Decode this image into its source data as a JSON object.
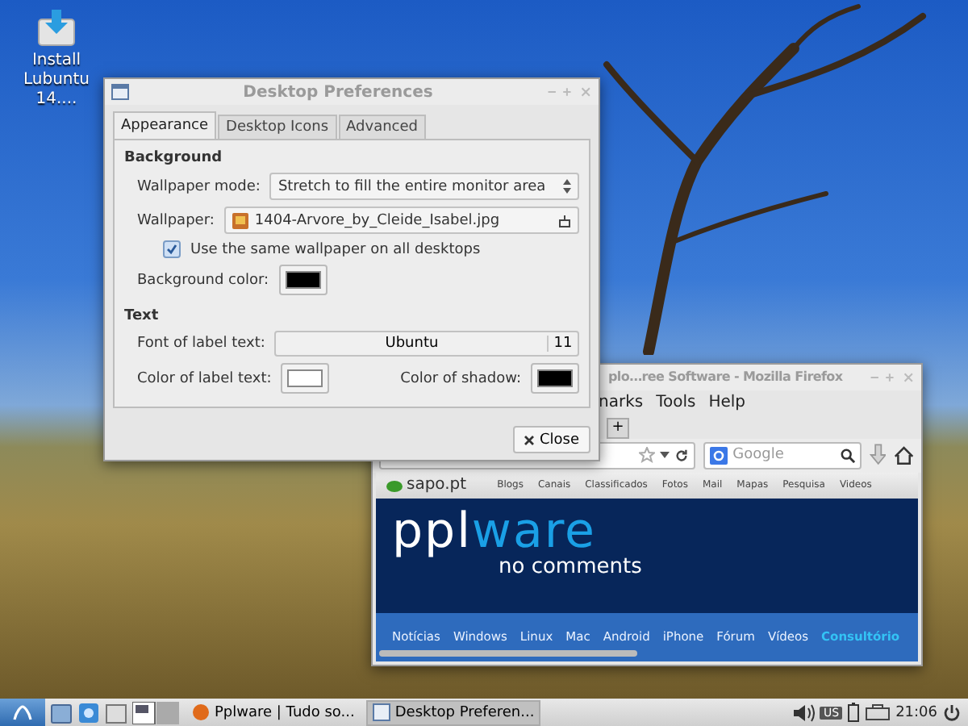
{
  "desktop_icons": [
    {
      "label": "Install\nLubuntu 14...."
    }
  ],
  "preferences_dialog": {
    "title": "Desktop Preferences",
    "tabs": [
      {
        "label": "Appearance",
        "selected": true
      },
      {
        "label": "Desktop Icons",
        "selected": false
      },
      {
        "label": "Advanced",
        "selected": false
      }
    ],
    "background": {
      "heading": "Background",
      "wallpaper_mode_label": "Wallpaper mode:",
      "wallpaper_mode": "Stretch to fill the entire monitor area",
      "wallpaper_label": "Wallpaper:",
      "wallpaper_file": "1404-Arvore_by_Cleide_Isabel.jpg",
      "same_wallpaper": {
        "label": "Use the same wallpaper on all desktops",
        "checked": true
      },
      "background_color_label": "Background color:",
      "background_color_button": {
        "color": "#000000"
      }
    },
    "text": {
      "heading": "Text",
      "font_label": "Font of label text:",
      "font_name": "Ubuntu",
      "font_size": "11",
      "label_color_label": "Color of label text:",
      "label_color_button": {
        "color": "#ffffff"
      },
      "shadow_label": "Color of shadow:",
      "shadow_color_button": {
        "color": "#000000"
      }
    },
    "close_button": "Close"
  },
  "firefox_window": {
    "title": "plo…ree Software - Mozilla Firefox",
    "menu": [
      "narks",
      "Tools",
      "Help"
    ],
    "new_tab_button": "+",
    "search_placeholder": "Google",
    "webpage": {
      "site_logo": "sapo.pt",
      "top_links": [
        "Blogs",
        "Canais",
        "Classificados",
        "Fotos",
        "Mail",
        "Mapas",
        "Pesquisa",
        "Videos"
      ],
      "banner": {
        "logo_start": "ppl",
        "logo_end": "ware",
        "tagline": "no comments"
      },
      "nav": [
        {
          "label": "Notícias",
          "selected": false
        },
        {
          "label": "Windows",
          "selected": false
        },
        {
          "label": "Linux",
          "selected": false
        },
        {
          "label": "Mac",
          "selected": false
        },
        {
          "label": "Android",
          "selected": false
        },
        {
          "label": "iPhone",
          "selected": false
        },
        {
          "label": "Fórum",
          "selected": false
        },
        {
          "label": "Vídeos",
          "selected": false
        },
        {
          "label": "Consultório",
          "selected": true
        }
      ]
    }
  },
  "taskbar": {
    "tasks": [
      {
        "label": "Pplware | Tudo so...",
        "selected": false
      },
      {
        "label": "Desktop Preferen...",
        "selected": true
      }
    ],
    "keyboard_layout": "US",
    "clock": "21:06"
  }
}
